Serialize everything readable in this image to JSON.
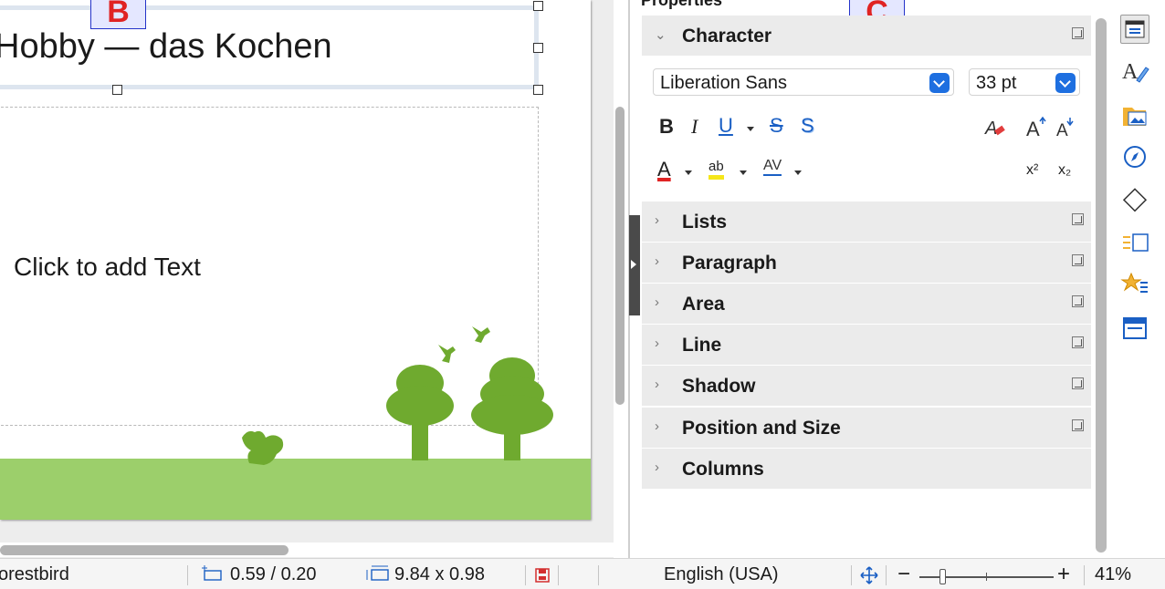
{
  "slide": {
    "title": "Hobby — das Kochen",
    "content_placeholder": "Click to add Text",
    "markers": {
      "b": "B",
      "c": "C"
    }
  },
  "sidebar": {
    "deck_title": "Properties",
    "character": {
      "label": "Character",
      "font_name": "Liberation Sans",
      "font_size": "33 pt",
      "buttons": {
        "bold": "B",
        "italic": "I",
        "underline": "U",
        "strike": "S",
        "shadow": "S",
        "font_color": "A",
        "highlight": "ab",
        "spacing": "AV",
        "superscript": "x²",
        "subscript": "x₂"
      },
      "icons": [
        "clear-formatting-icon",
        "grow-font-icon",
        "shrink-font-icon"
      ]
    },
    "sections": [
      {
        "label": "Lists",
        "more": true
      },
      {
        "label": "Paragraph",
        "more": true
      },
      {
        "label": "Area",
        "more": true
      },
      {
        "label": "Line",
        "more": true
      },
      {
        "label": "Shadow",
        "more": true
      },
      {
        "label": "Position and Size",
        "more": true
      },
      {
        "label": "Columns",
        "more": false
      }
    ],
    "tabs": [
      "properties-icon",
      "styles-icon",
      "gallery-icon",
      "navigator-icon",
      "shapes-icon",
      "slide-transition-icon",
      "animation-icon",
      "master-slides-icon"
    ]
  },
  "status": {
    "master_slide": "orestbird",
    "position": "0.59 / 0.20",
    "size": "9.84 x 0.98",
    "language": "English (USA)",
    "zoom": "41%",
    "zoom_minus": "−",
    "zoom_plus": "+"
  },
  "colors": {
    "accent": "#1e6fe0",
    "grass": "#9ccf6b",
    "tree": "#6faa2f",
    "marker_text": "#e02323",
    "marker_border": "#2433c9"
  }
}
